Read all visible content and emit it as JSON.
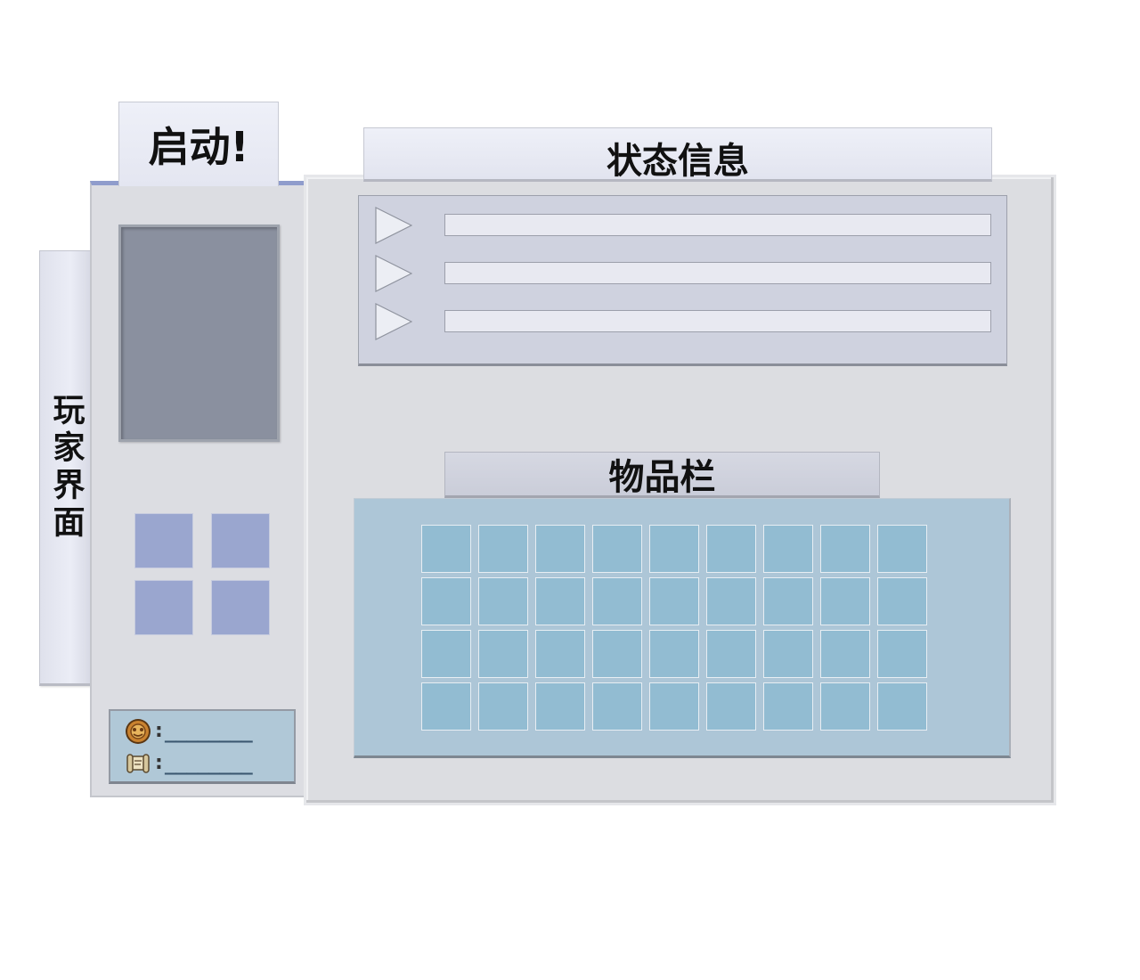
{
  "side_tab": {
    "label": "玩家界面"
  },
  "start_tab": {
    "label": "启动!"
  },
  "player_panel": {
    "equipment_slot_count": 4,
    "currency": [
      {
        "icon": "coin-icon",
        "value": "________"
      },
      {
        "icon": "scroll-icon",
        "value": "________"
      }
    ]
  },
  "status": {
    "title": "状态信息",
    "rows": [
      {
        "icon": "play-arrow-icon",
        "text": ""
      },
      {
        "icon": "play-arrow-icon",
        "text": ""
      },
      {
        "icon": "play-arrow-icon",
        "text": ""
      }
    ]
  },
  "inventory": {
    "title": "物品栏",
    "columns": 9,
    "rows": 4
  },
  "colors": {
    "panel_accent": "#8f9ccc",
    "equipment_slot": "#9aa6cf",
    "inventory_bg": "#adc6d7",
    "inventory_slot": "#92bcd2",
    "portrait": "#8a909f"
  }
}
